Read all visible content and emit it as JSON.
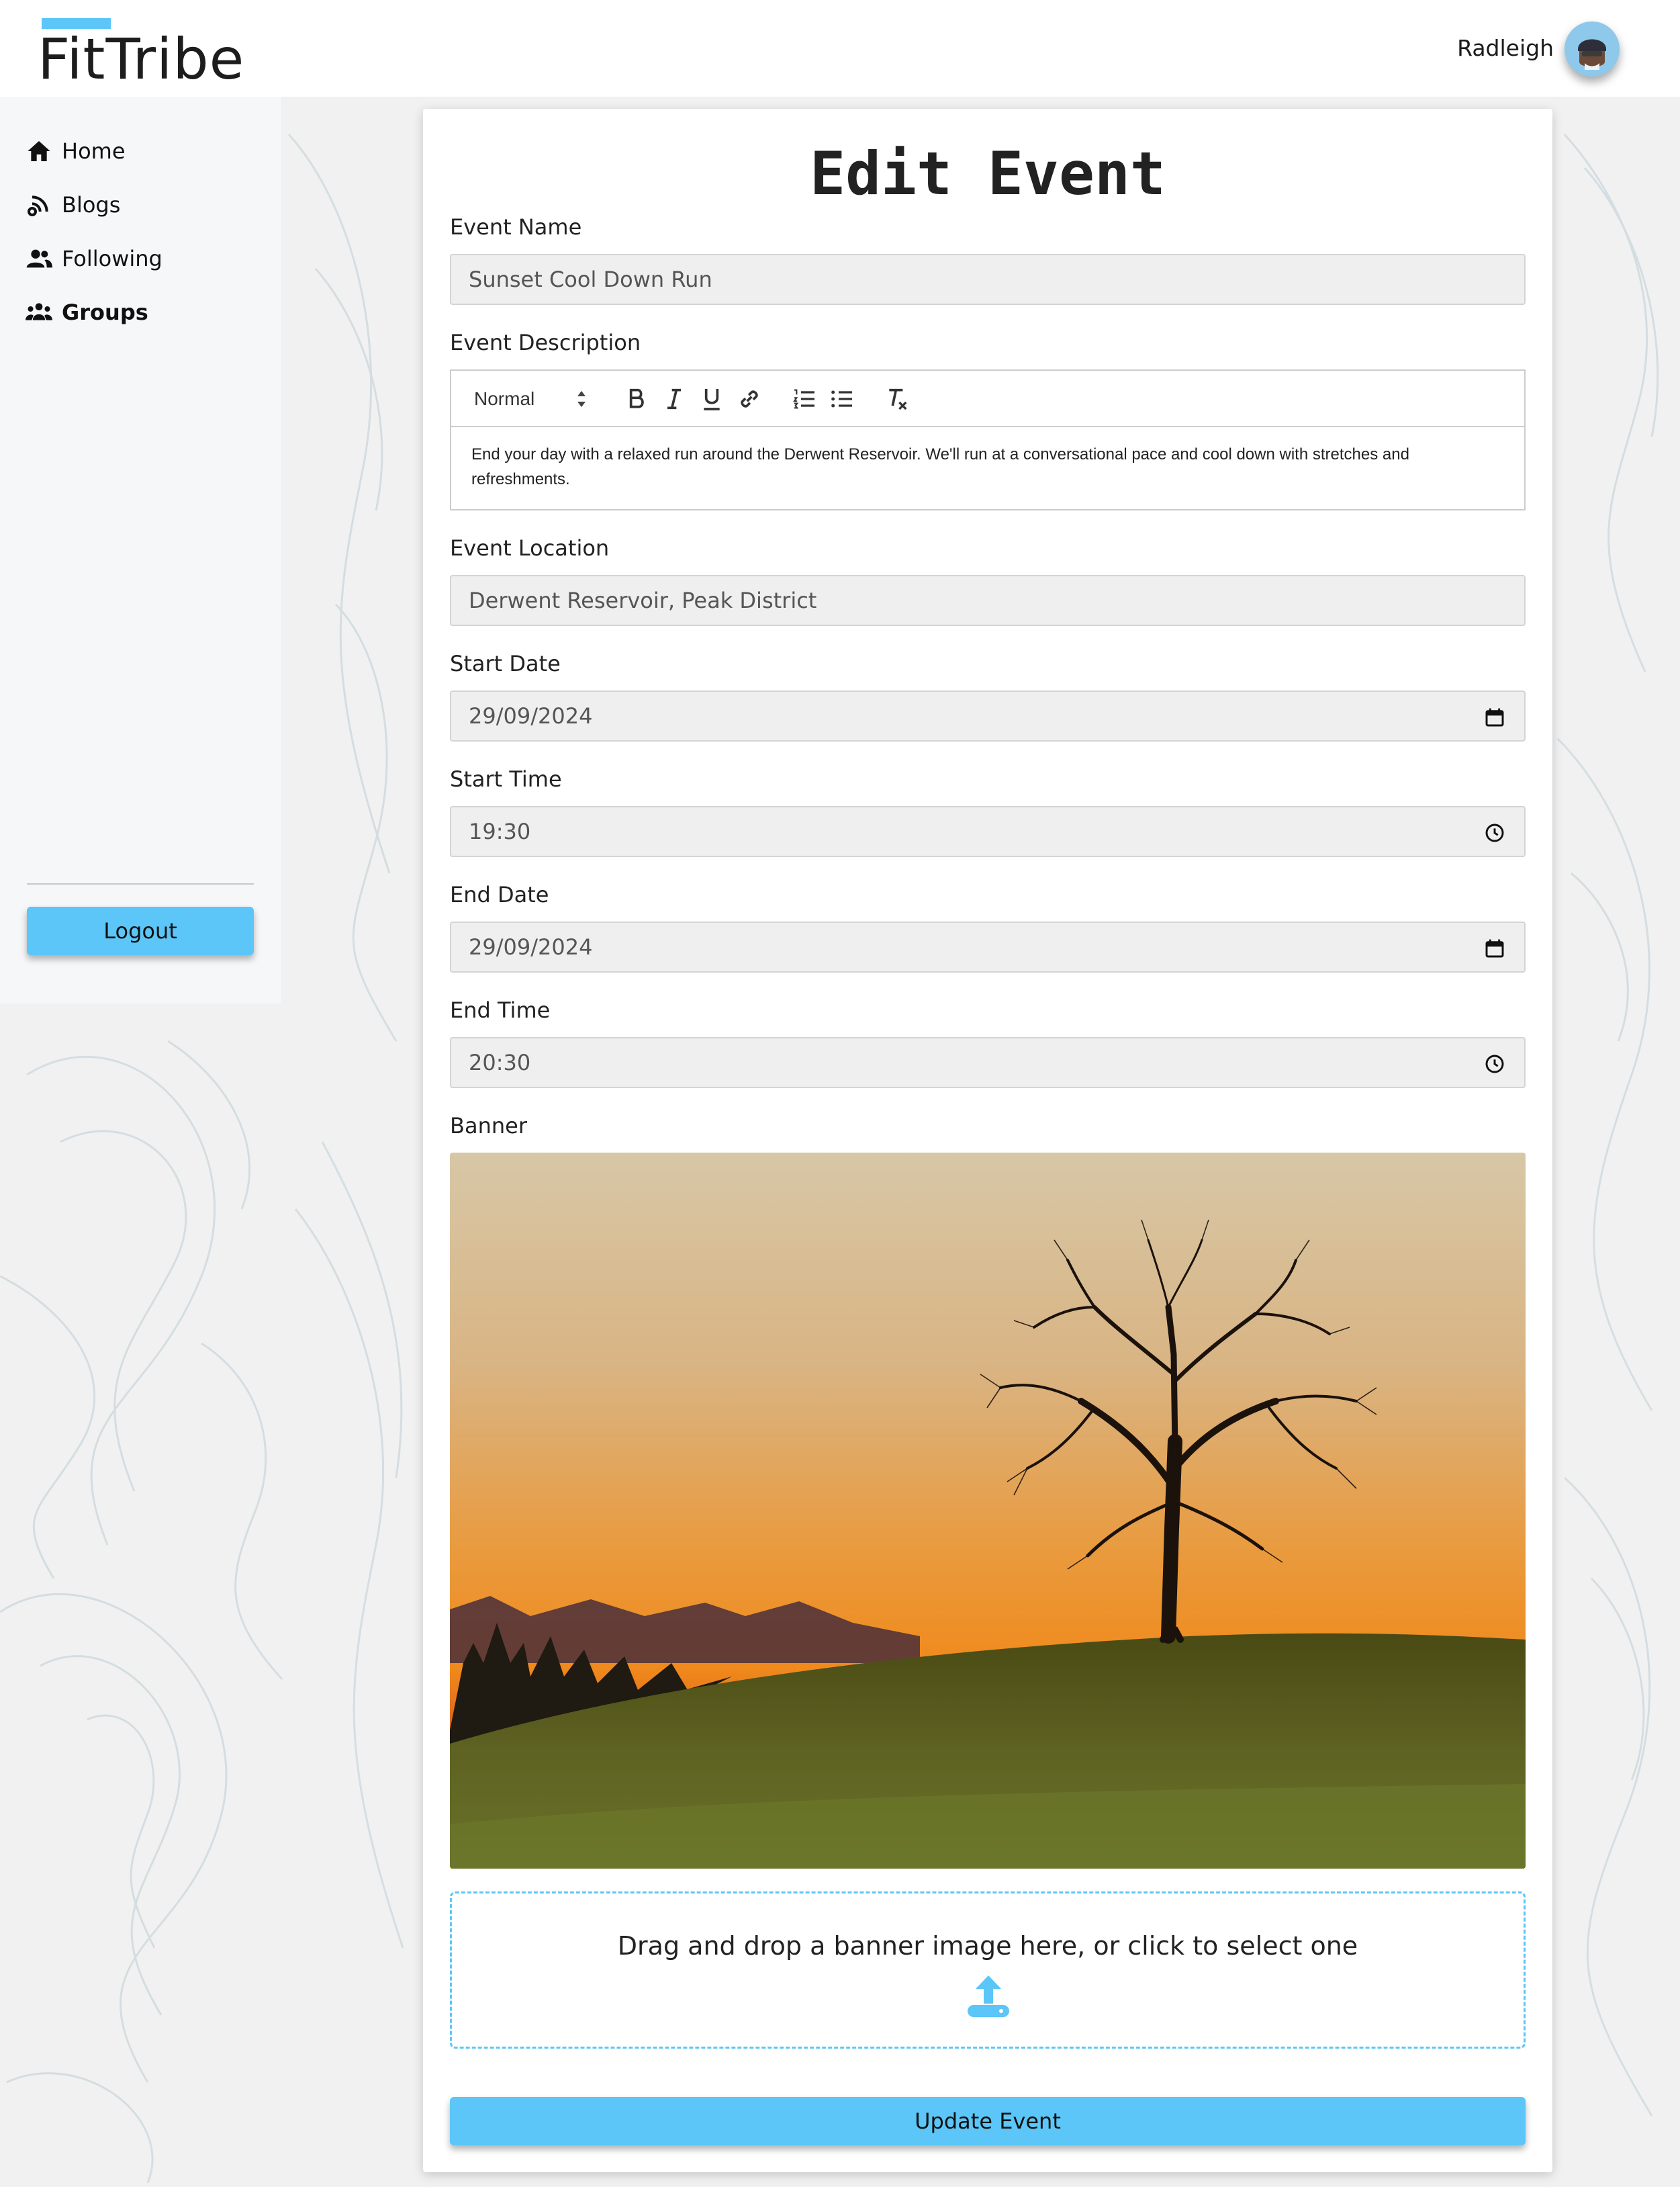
{
  "app": {
    "name": "FitTribe",
    "brand_color": "#5bc6f7"
  },
  "header": {
    "user_name": "Radleigh",
    "avatar_icon": "user-avatar"
  },
  "sidebar": {
    "items": [
      {
        "label": "Home",
        "icon": "home-icon"
      },
      {
        "label": "Blogs",
        "icon": "blogs-icon"
      },
      {
        "label": "Following",
        "icon": "following-icon"
      },
      {
        "label": "Groups",
        "icon": "groups-icon",
        "active": true
      }
    ],
    "logout_label": "Logout"
  },
  "form": {
    "title": "Edit Event",
    "event_name": {
      "label": "Event Name",
      "value": "Sunset Cool Down Run"
    },
    "event_description": {
      "label": "Event Description",
      "format": "Normal",
      "toolbar": [
        "bold-icon",
        "italic-icon",
        "underline-icon",
        "link-icon",
        "ordered-list-icon",
        "bullet-list-icon",
        "clear-format-icon"
      ],
      "value": "End your day with a relaxed run around the Derwent Reservoir. We'll run at a conversational pace and cool down with stretches and refreshments."
    },
    "event_location": {
      "label": "Event Location",
      "value": "Derwent Reservoir, Peak District"
    },
    "start_date": {
      "label": "Start Date",
      "value": "29/09/2024"
    },
    "start_time": {
      "label": "Start Time",
      "value": "19:30"
    },
    "end_date": {
      "label": "End Date",
      "value": "29/09/2024"
    },
    "end_time": {
      "label": "End Time",
      "value": "20:30"
    },
    "banner": {
      "label": "Banner",
      "dropzone_text": "Drag and drop a banner image here, or click to select one"
    },
    "submit_label": "Update Event"
  }
}
